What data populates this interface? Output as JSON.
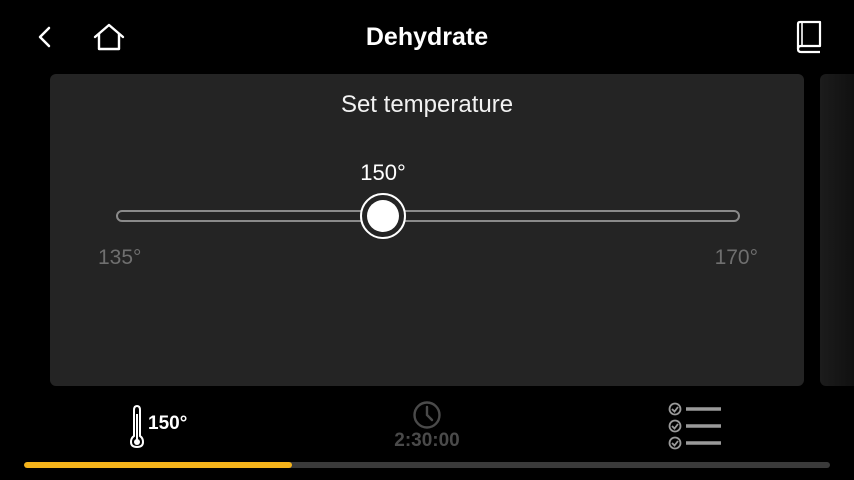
{
  "header": {
    "title": "Dehydrate",
    "back_icon": "chevron-left-icon",
    "home_icon": "home-icon",
    "guide_icon": "book-icon"
  },
  "card": {
    "title": "Set temperature",
    "slider": {
      "value": 150,
      "value_label": "150°",
      "min": 135,
      "max": 170,
      "min_label": "135°",
      "max_label": "170°"
    }
  },
  "status": {
    "temperature": "150°",
    "temperature_icon": "thermometer-icon",
    "timer": "2:30:00",
    "timer_icon": "clock-icon",
    "steps_icon": "checklist-icon"
  },
  "progress": {
    "fraction": 0.333,
    "color": "#f5b31a"
  }
}
